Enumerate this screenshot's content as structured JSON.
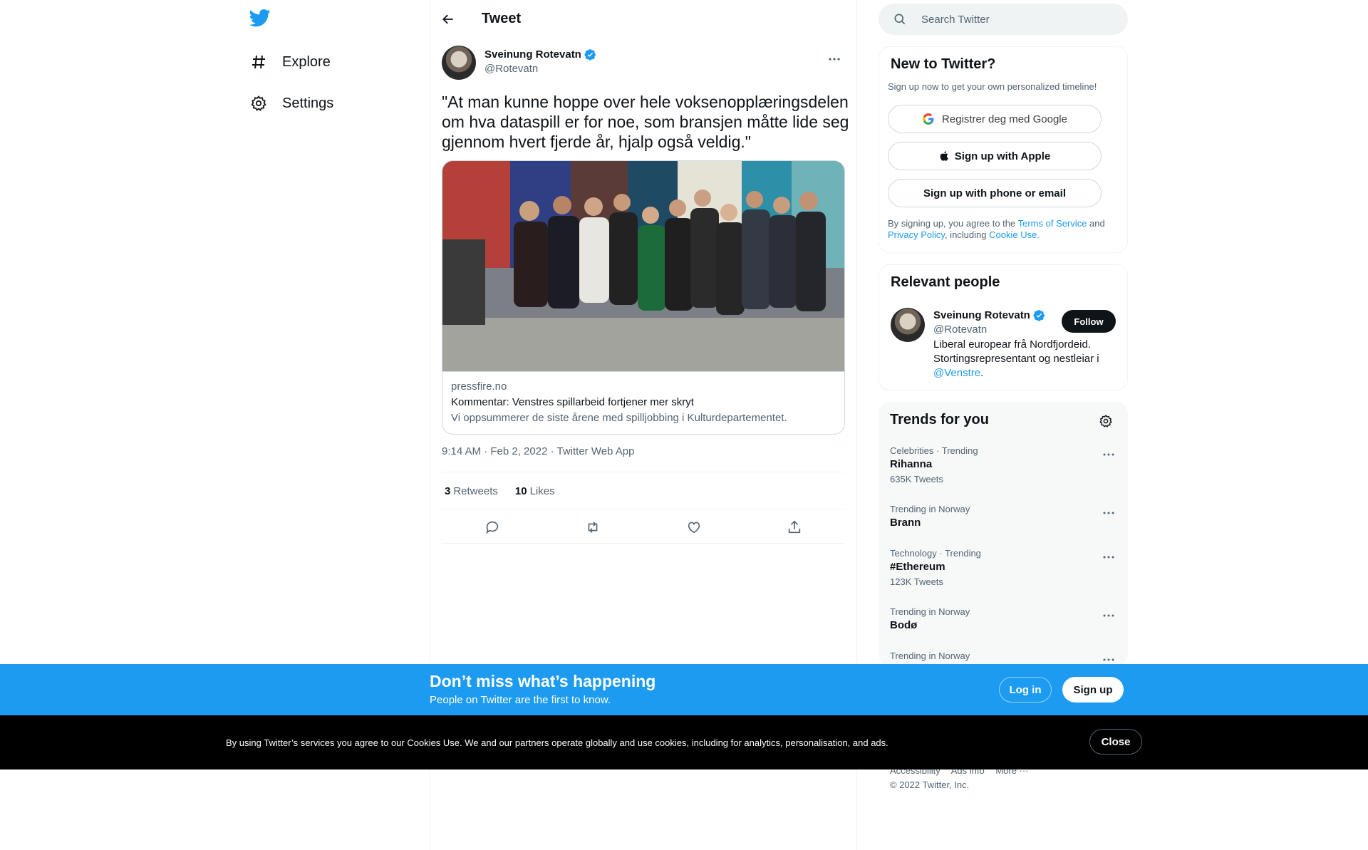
{
  "nav": {
    "logo_icon": "twitter-bird-icon",
    "items": [
      {
        "label": "Explore",
        "icon": "hashtag-icon"
      },
      {
        "label": "Settings",
        "icon": "gear-icon"
      }
    ]
  },
  "header": {
    "title": "Tweet",
    "back_icon": "arrow-left-icon"
  },
  "tweet": {
    "author_name": "Sveinung Rotevatn",
    "author_handle": "@Rotevatn",
    "text": "\"At man kunne hoppe over hele voksenopplæringsdelen om hva dataspill er for noe, som bransjen måtte lide seg gjennom hvert fjerde år, hjalp også veldig.\"",
    "card": {
      "domain": "pressfire.no",
      "title": "Kommentar: Venstres spillarbeid fortjener mer skryt",
      "description": "Vi oppsummerer de siste årene med spilljobbing i Kulturdepartementet."
    },
    "meta": "9:14 AM · Feb 2, 2022 · Twitter Web App",
    "retweets_count": "3",
    "retweets_label": "Retweets",
    "likes_count": "10",
    "likes_label": "Likes"
  },
  "search": {
    "placeholder": "Search Twitter"
  },
  "new_to_twitter": {
    "title": "New to Twitter?",
    "subtitle": "Sign up now to get your own personalized timeline!",
    "google_label": "Registrer deg med Google",
    "apple_label": "Sign up with Apple",
    "phone_label": "Sign up with phone or email",
    "legal_pre": "By signing up, you agree to the ",
    "tos": "Terms of Service",
    "and": " and ",
    "privacy": "Privacy Policy",
    "including": ", including ",
    "cookie": "Cookie Use."
  },
  "relevant": {
    "title": "Relevant people",
    "name": "Sveinung Rotevatn",
    "handle": "@Rotevatn",
    "follow": "Follow",
    "bio_text": "Liberal europear frå Nordfjordeid. Stortingsrepresentant og nestleiar i ",
    "bio_link": "@Venstre",
    "bio_end": "."
  },
  "trends": {
    "title": "Trends for you",
    "items": [
      {
        "context": "Celebrities · Trending",
        "name": "Rihanna",
        "count": "635K Tweets"
      },
      {
        "context": "Trending in Norway",
        "name": "Brann",
        "count": ""
      },
      {
        "context": "Technology · Trending",
        "name": "#Ethereum",
        "count": "123K Tweets"
      },
      {
        "context": "Trending in Norway",
        "name": "Bodø",
        "count": ""
      },
      {
        "context": "Trending in Norway",
        "name": "",
        "count": ""
      }
    ]
  },
  "footer": {
    "links": [
      "Accessibility",
      "Ads info",
      "More ···"
    ],
    "copyright": "© 2022 Twitter, Inc."
  },
  "signup_bar": {
    "title": "Don’t miss what’s happening",
    "subtitle": "People on Twitter are the first to know.",
    "login": "Log in",
    "signup": "Sign up"
  },
  "cookie_bar": {
    "text": "By using Twitter’s services you agree to our Cookies Use. We and our partners operate globally and use cookies, including for analytics, personalisation, and ads.",
    "close": "Close"
  },
  "colors": {
    "accent": "#1d9bf0",
    "text": "#0f1419",
    "muted": "#536471"
  }
}
